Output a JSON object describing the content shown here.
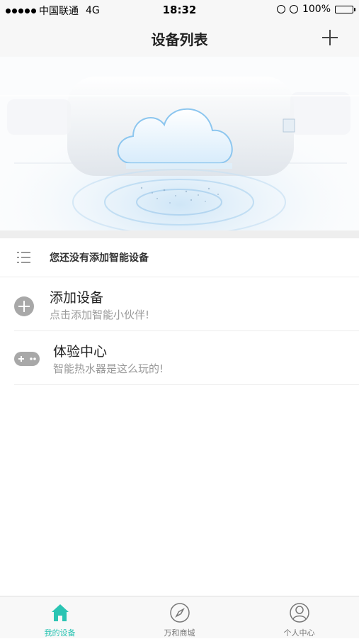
{
  "status_bar": {
    "carrier": "中国联通",
    "network": "4G",
    "time": "18:32",
    "battery": "100%"
  },
  "nav": {
    "title": "设备列表"
  },
  "empty_notice": "您还没有添加智能设备",
  "actions": [
    {
      "title": "添加设备",
      "subtitle": "点击添加智能小伙伴!"
    },
    {
      "title": "体验中心",
      "subtitle": "智能热水器是这么玩的!"
    }
  ],
  "tabs": [
    {
      "label": "我的设备",
      "icon": "home-icon",
      "active": true
    },
    {
      "label": "万和商城",
      "icon": "compass-icon",
      "active": false
    },
    {
      "label": "个人中心",
      "icon": "user-icon",
      "active": false
    }
  ],
  "colors": {
    "accent": "#2bc4b3",
    "icon_grey": "#a8a8a8",
    "subtitle_grey": "#9a9a9a"
  }
}
